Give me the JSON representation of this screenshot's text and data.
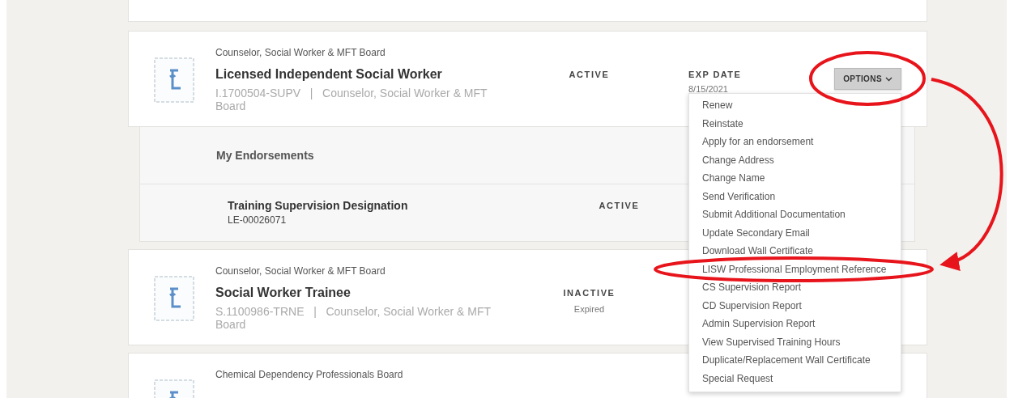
{
  "licenses": [
    {
      "board": "Counselor, Social Worker & MFT Board",
      "title": "Licensed Independent Social Worker",
      "detail": "I.1700504-SUPV   |   Counselor, Social Worker & MFT Board",
      "status": "ACTIVE",
      "expiration": {
        "label": "EXP DATE",
        "value": "8/15/2021"
      },
      "options": {
        "label": "OPTIONS",
        "expanded": true,
        "items": [
          "Renew",
          "Reinstate",
          "Apply for an endorsement",
          "Change Address",
          "Change Name",
          "Send Verification",
          "Submit Additional Documentation",
          "Update Secondary Email",
          "Download Wall Certificate",
          "LISW Professional Employment Reference",
          "CS Supervision Report",
          "CD Supervision Report",
          "Admin Supervision Report",
          "View Supervised Training Hours",
          "Duplicate/Replacement Wall Certificate",
          "Special Request"
        ]
      },
      "endorsements": {
        "heading": "My Endorsements",
        "items": [
          {
            "title": "Training Supervision Designation",
            "number": "LE-00026071",
            "status": "ACTIVE"
          }
        ]
      }
    },
    {
      "board": "Counselor, Social Worker & MFT Board",
      "title": "Social Worker Trainee",
      "detail": "S.1100986-TRNE   |   Counselor, Social Worker & MFT Board",
      "status": "INACTIVE",
      "status_note": "Expired"
    },
    {
      "board": "Chemical Dependency Professionals Board"
    }
  ]
}
